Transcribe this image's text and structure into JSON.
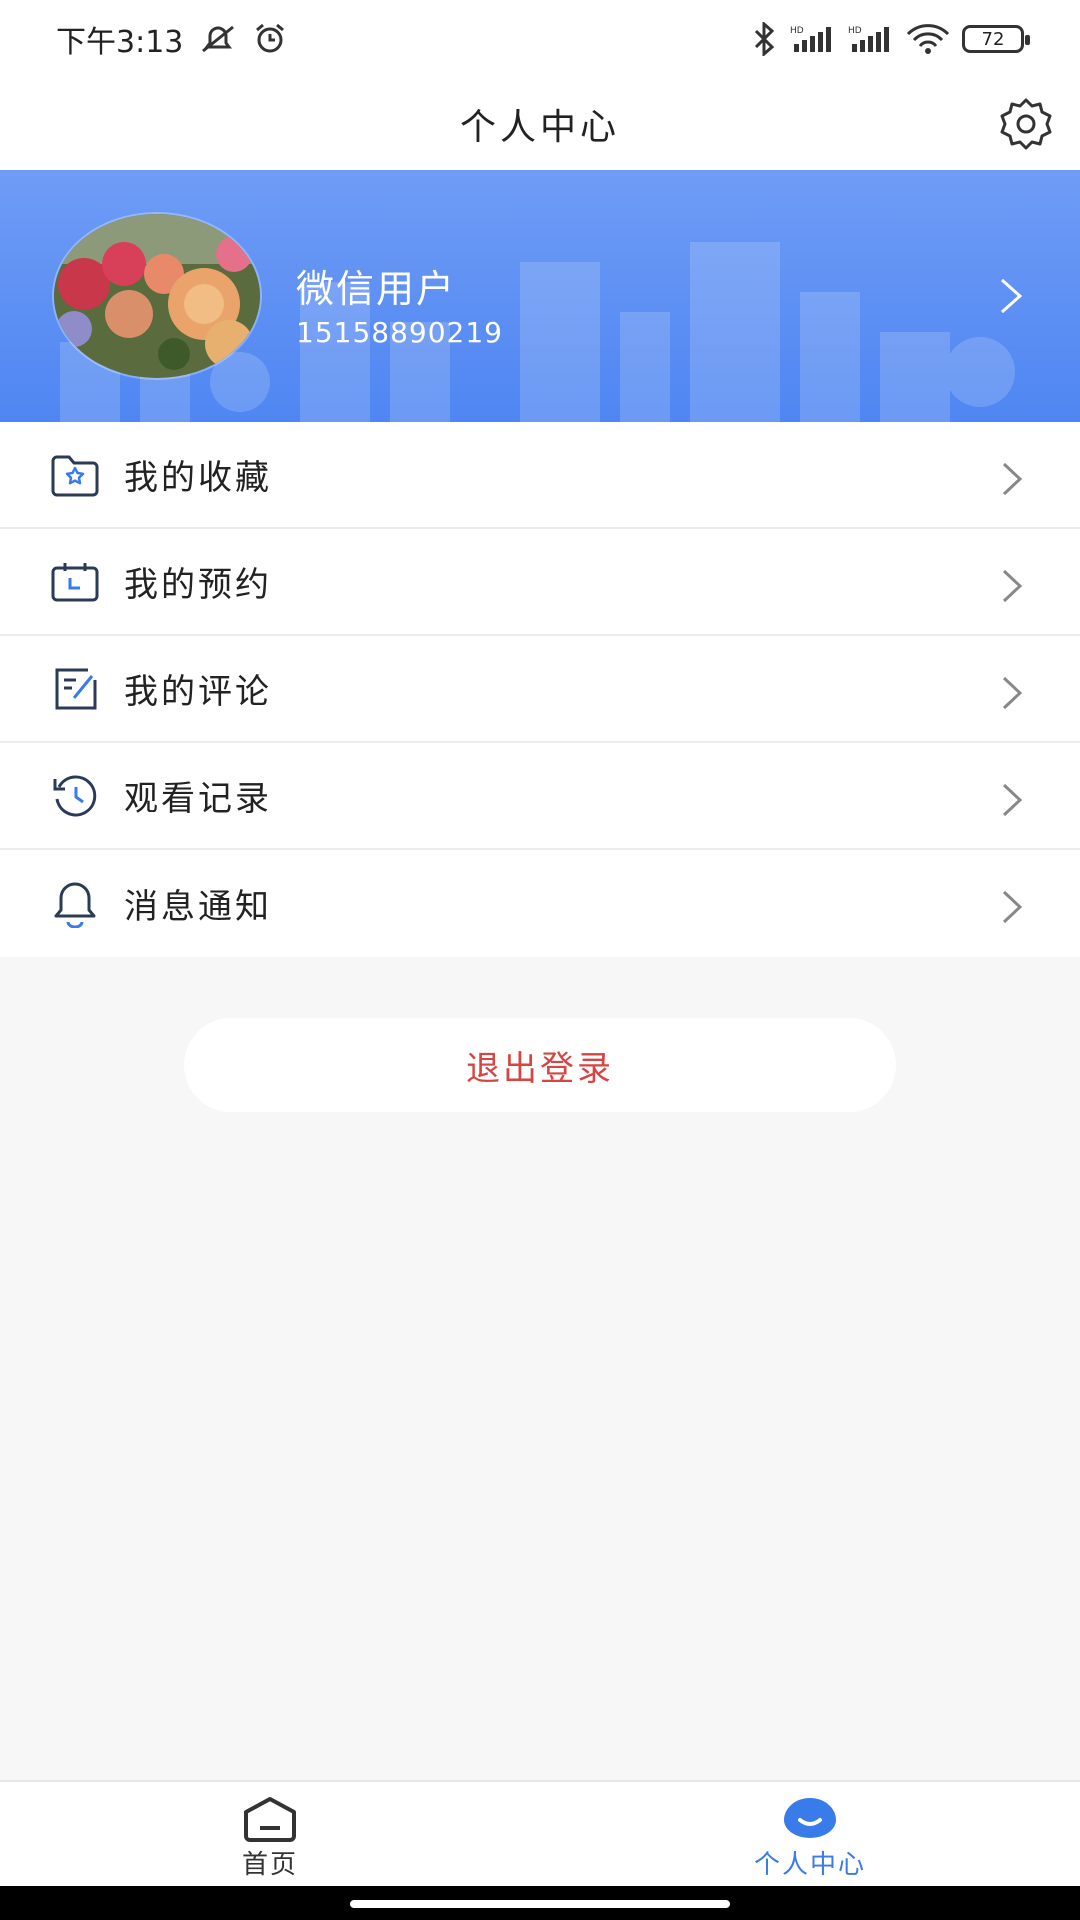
{
  "status": {
    "time": "下午3:13",
    "battery": "72"
  },
  "header": {
    "title": "个人中心"
  },
  "profile": {
    "name": "微信用户",
    "phone": "15158890219"
  },
  "menu": {
    "items": [
      {
        "label": "我的收藏",
        "icon": "folder-star-icon"
      },
      {
        "label": "我的预约",
        "icon": "calendar-icon"
      },
      {
        "label": "我的评论",
        "icon": "edit-note-icon"
      },
      {
        "label": "观看记录",
        "icon": "history-icon"
      },
      {
        "label": "消息通知",
        "icon": "bell-icon"
      }
    ]
  },
  "logout": {
    "label": "退出登录"
  },
  "tabbar": {
    "tabs": [
      {
        "label": "首页",
        "icon": "home-icon"
      },
      {
        "label": "个人中心",
        "icon": "profile-icon",
        "active": true
      }
    ]
  },
  "colors": {
    "brand_blue": "#4f86f2",
    "active_tab": "#3a7bea",
    "logout_red": "#d64541",
    "icon_navy": "#2b3a55"
  }
}
